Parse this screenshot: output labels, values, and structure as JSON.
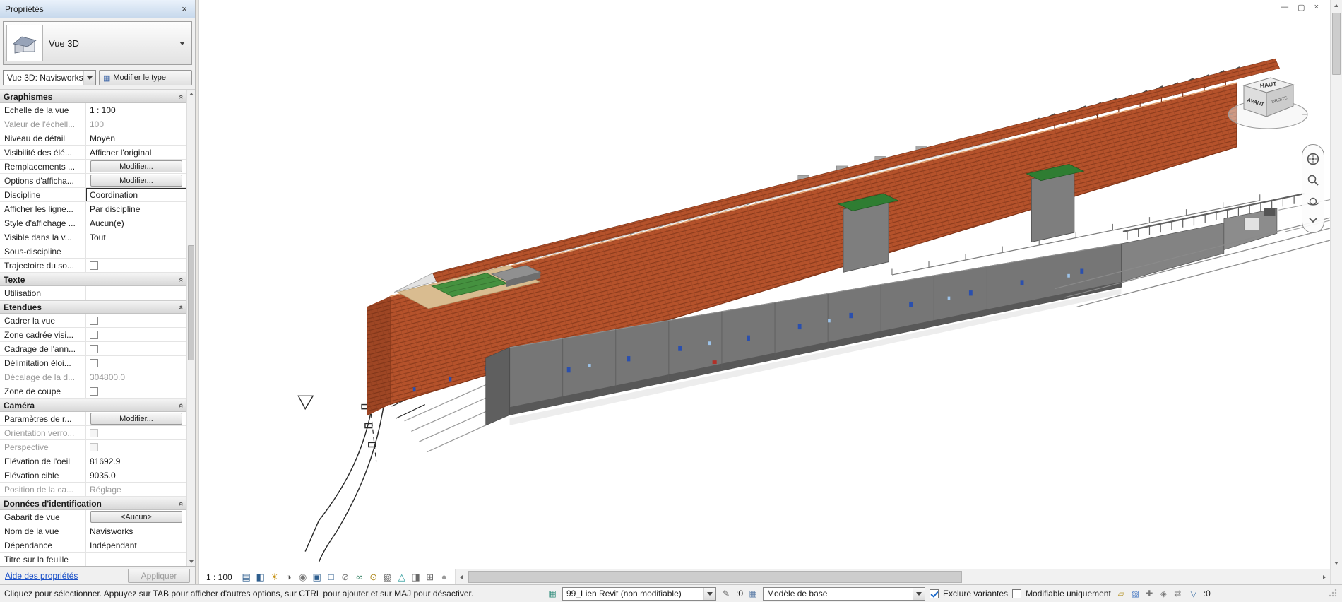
{
  "colors": {
    "facade_orange": "#b5522b",
    "facade_orange_dark": "#7e3317",
    "building_gray": "#767676",
    "roof_green": "#2f7d32",
    "roof_tan": "#d9bc90",
    "accent_blue": "#2a4fae"
  },
  "icons": {
    "collapse": "«",
    "close": "×",
    "minimize": "—",
    "restore": "▢",
    "modify_type": "▦",
    "worksets": "▦",
    "editing_requests": "✎",
    "design_options": "▦",
    "filter": "▽"
  },
  "properties_panel": {
    "title": "Propriétés",
    "type_selector": {
      "label": "Vue 3D"
    },
    "view_selector": {
      "value": "Vue 3D: Navisworks",
      "modify_type": "Modifier le type"
    },
    "sections": [
      {
        "title": "Graphismes",
        "rows": [
          {
            "label": "Echelle de la vue",
            "value": "1 : 100",
            "kind": "text"
          },
          {
            "label": "Valeur de l'échell...",
            "value": "100",
            "kind": "text",
            "disabled": true
          },
          {
            "label": "Niveau de détail",
            "value": "Moyen",
            "kind": "text"
          },
          {
            "label": "Visibilité des élé...",
            "value": "Afficher l'original",
            "kind": "text"
          },
          {
            "label": "Remplacements ...",
            "value": "Modifier...",
            "kind": "button"
          },
          {
            "label": "Options d'afficha...",
            "value": "Modifier...",
            "kind": "button"
          },
          {
            "label": "Discipline",
            "value": "Coordination",
            "kind": "text",
            "selected": true
          },
          {
            "label": "Afficher les ligne...",
            "value": "Par discipline",
            "kind": "text"
          },
          {
            "label": "Style d'affichage ...",
            "value": "Aucun(e)",
            "kind": "text"
          },
          {
            "label": "Visible dans la v...",
            "value": "Tout",
            "kind": "text"
          },
          {
            "label": "Sous-discipline",
            "value": "",
            "kind": "text"
          },
          {
            "label": "Trajectoire du so...",
            "kind": "check",
            "checked": false
          }
        ]
      },
      {
        "title": "Texte",
        "rows": [
          {
            "label": "Utilisation",
            "value": "",
            "kind": "text"
          }
        ]
      },
      {
        "title": "Etendues",
        "rows": [
          {
            "label": "Cadrer la vue",
            "kind": "check",
            "checked": false
          },
          {
            "label": "Zone cadrée visi...",
            "kind": "check",
            "checked": false
          },
          {
            "label": "Cadrage de l'ann...",
            "kind": "check",
            "checked": false
          },
          {
            "label": "Délimitation éloi...",
            "kind": "check",
            "checked": false
          },
          {
            "label": "Décalage de la d...",
            "value": "304800.0",
            "kind": "text",
            "disabled": true
          },
          {
            "label": "Zone de coupe",
            "kind": "check",
            "checked": false
          }
        ]
      },
      {
        "title": "Caméra",
        "rows": [
          {
            "label": "Paramètres de r...",
            "value": "Modifier...",
            "kind": "button"
          },
          {
            "label": "Orientation verro...",
            "kind": "check",
            "checked": false,
            "disabled": true
          },
          {
            "label": "Perspective",
            "kind": "check",
            "checked": false,
            "disabled": true
          },
          {
            "label": "Elévation de l'oeil",
            "value": "81692.9",
            "kind": "text"
          },
          {
            "label": "Elévation cible",
            "value": "9035.0",
            "kind": "text"
          },
          {
            "label": "Position de la ca...",
            "value": "Réglage",
            "kind": "text",
            "disabled": true
          }
        ]
      },
      {
        "title": "Données d'identification",
        "rows": [
          {
            "label": "Gabarit de vue",
            "value": "<Aucun>",
            "kind": "button"
          },
          {
            "label": "Nom de la vue",
            "value": "Navisworks",
            "kind": "text"
          },
          {
            "label": "Dépendance",
            "value": "Indépendant",
            "kind": "text"
          },
          {
            "label": "Titre sur la feuille",
            "value": "",
            "kind": "text"
          }
        ]
      }
    ],
    "footer": {
      "help_link": "Aide des propriétés",
      "apply_label": "Appliquer"
    }
  },
  "viewport": {
    "viewcube": {
      "top": "HAUT",
      "front": "AVANT",
      "right": "DROITE"
    },
    "view_control_bar": {
      "scale": "1 : 100",
      "icons": [
        {
          "name": "detail-level-icon",
          "glyph": "▤",
          "color": "#2e5e8e"
        },
        {
          "name": "visual-style-icon",
          "glyph": "◧",
          "color": "#2e5e8e"
        },
        {
          "name": "sun-path-icon",
          "glyph": "☀",
          "color": "#c79418"
        },
        {
          "name": "shadows-icon",
          "glyph": "◑",
          "color": "#4d4d4d"
        },
        {
          "name": "rendering-dialog-icon",
          "glyph": "◉",
          "color": "#777777"
        },
        {
          "name": "crop-view-icon",
          "glyph": "▣",
          "color": "#2e5e8e"
        },
        {
          "name": "show-crop-region-icon",
          "glyph": "□",
          "color": "#2e5e8e"
        },
        {
          "name": "lock-3d-view-icon",
          "glyph": "⊘",
          "color": "#777777"
        },
        {
          "name": "hide-isolate-icon",
          "glyph": "∞",
          "color": "#2e7d5e"
        },
        {
          "name": "reveal-hidden-icon",
          "glyph": "⊙",
          "color": "#b08a20"
        },
        {
          "name": "temporary-view-properties-icon",
          "glyph": "▧",
          "color": "#6a6a6a"
        },
        {
          "name": "analytical-model-icon",
          "glyph": "△",
          "color": "#2a9a9a"
        },
        {
          "name": "highlight-displacement-icon",
          "glyph": "◨",
          "color": "#6a6a6a"
        },
        {
          "name": "reveal-constraints-icon",
          "glyph": "⊞",
          "color": "#6a6a6a"
        },
        {
          "name": "worksharing-display-icon",
          "glyph": "●",
          "color": "#9a9a9a"
        }
      ]
    }
  },
  "status_bar": {
    "hint": "Cliquez pour sélectionner. Appuyez sur TAB pour afficher d'autres options, sur CTRL pour ajouter et sur MAJ pour désactiver.",
    "workset": {
      "value": "99_Lien Revit (non modifiable)"
    },
    "editing_requests_count": ":0",
    "design_option": {
      "value": "Modèle de base"
    },
    "exclude_options_label": "Exclure variantes",
    "editable_only_label": "Modifiable uniquement",
    "toggles": [
      {
        "name": "select-links-toggle",
        "glyph": "▱",
        "color": "#b8962e"
      },
      {
        "name": "select-underlay-toggle",
        "glyph": "▨",
        "color": "#4a7bc4"
      },
      {
        "name": "select-pinned-toggle",
        "glyph": "✚",
        "color": "#777777"
      },
      {
        "name": "select-by-face-toggle",
        "glyph": "◈",
        "color": "#777777"
      },
      {
        "name": "drag-on-selection-toggle",
        "glyph": "⇄",
        "color": "#777777"
      }
    ],
    "filter_count": ":0"
  }
}
